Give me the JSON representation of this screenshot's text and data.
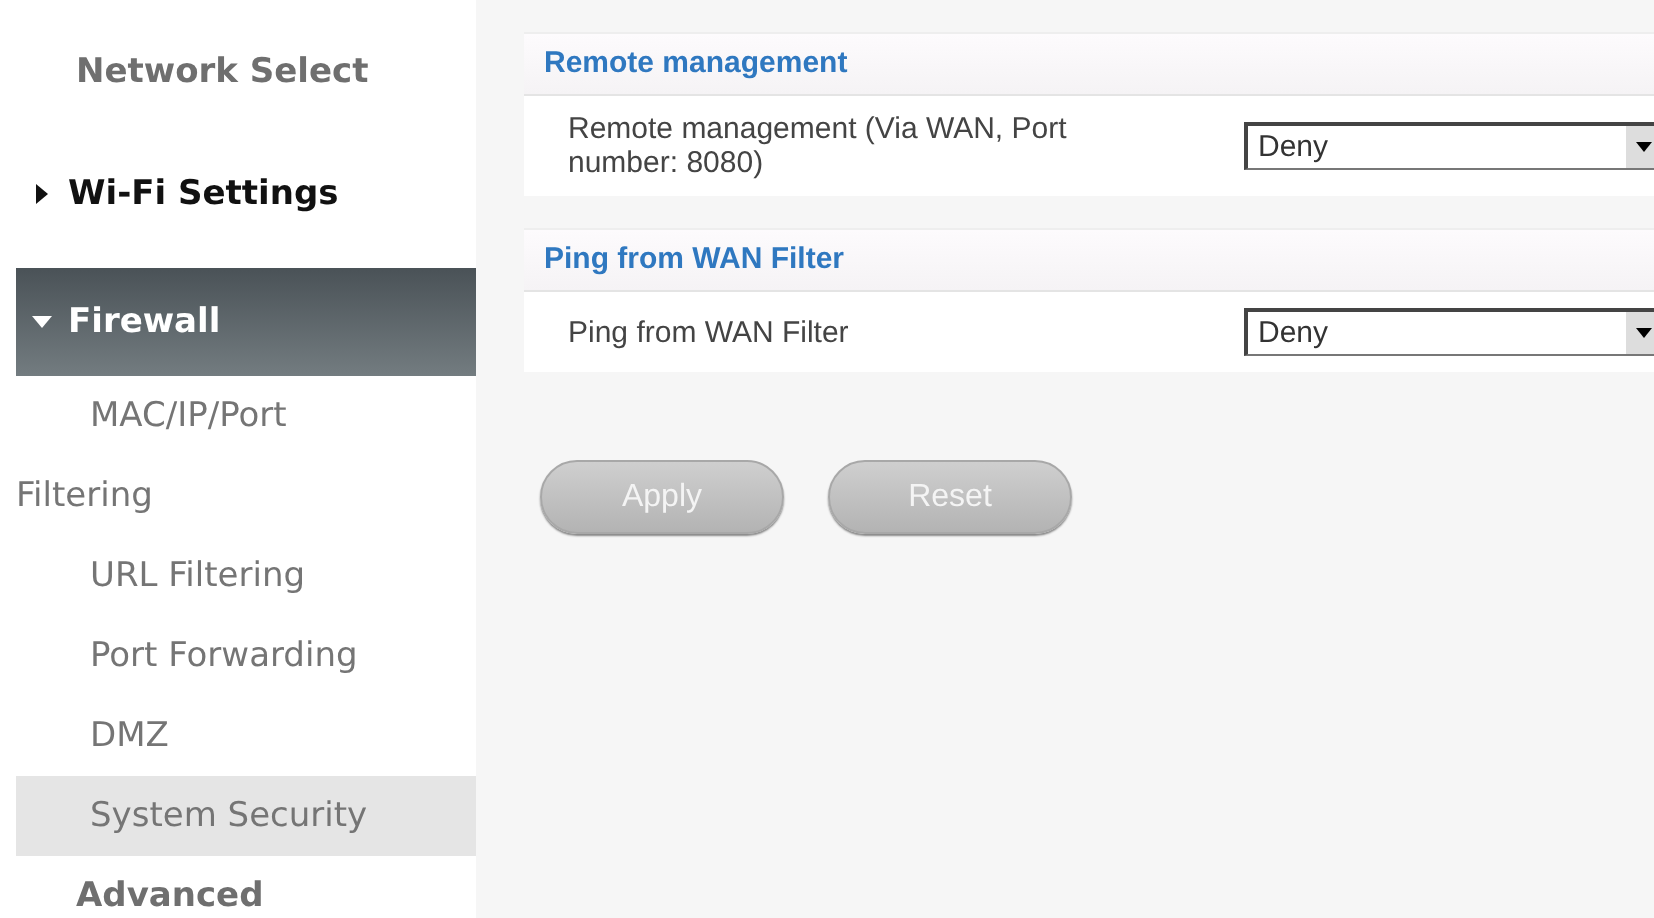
{
  "sidebar": {
    "items": [
      {
        "kind": "plain",
        "label": "Network Select"
      },
      {
        "kind": "collapsible",
        "label": "Wi-Fi Settings",
        "expanded": false
      },
      {
        "kind": "collapsible",
        "label": "Firewall",
        "expanded": true,
        "children": [
          {
            "label": "MAC/IP/Port Filtering",
            "selected": false
          },
          {
            "label": "URL Filtering",
            "selected": false
          },
          {
            "label": "Port Forwarding",
            "selected": false
          },
          {
            "label": "DMZ",
            "selected": false
          },
          {
            "label": "System Security",
            "selected": true
          }
        ]
      },
      {
        "kind": "plain",
        "label": "Advanced"
      }
    ]
  },
  "sections": [
    {
      "title": "Remote management",
      "rows": [
        {
          "label": "Remote management (Via WAN, Port number: 8080)",
          "value": "Deny"
        }
      ]
    },
    {
      "title": "Ping from WAN Filter",
      "rows": [
        {
          "label": "Ping from WAN Filter",
          "value": "Deny"
        }
      ]
    }
  ],
  "buttons": [
    "Apply",
    "Reset"
  ]
}
